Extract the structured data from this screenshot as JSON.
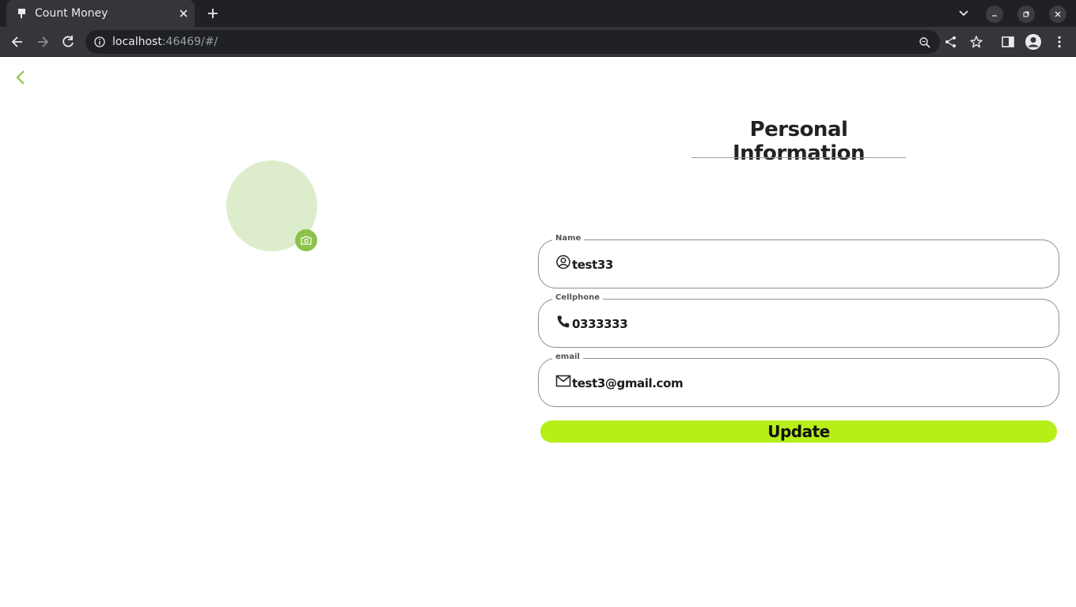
{
  "browser": {
    "tab_title": "Count Money",
    "url_host": "localhost",
    "url_rest": ":46469/#/"
  },
  "icons": {
    "back": "chevron-left-icon",
    "avatar_edit": "camera-icon",
    "name": "account-circle-icon",
    "cellphone": "phone-icon",
    "email": "mail-icon"
  },
  "colors": {
    "accent": "#8bc34a",
    "avatar_bg": "#ddedcc",
    "button_bg": "#b6ee18"
  },
  "profile": {
    "title": "Personal Information",
    "fields": [
      {
        "label": "Name",
        "value": "test33"
      },
      {
        "label": "Cellphone",
        "value": "0333333"
      },
      {
        "label": "email",
        "value": "test3@gmail.com"
      }
    ],
    "update_label": "Update"
  }
}
